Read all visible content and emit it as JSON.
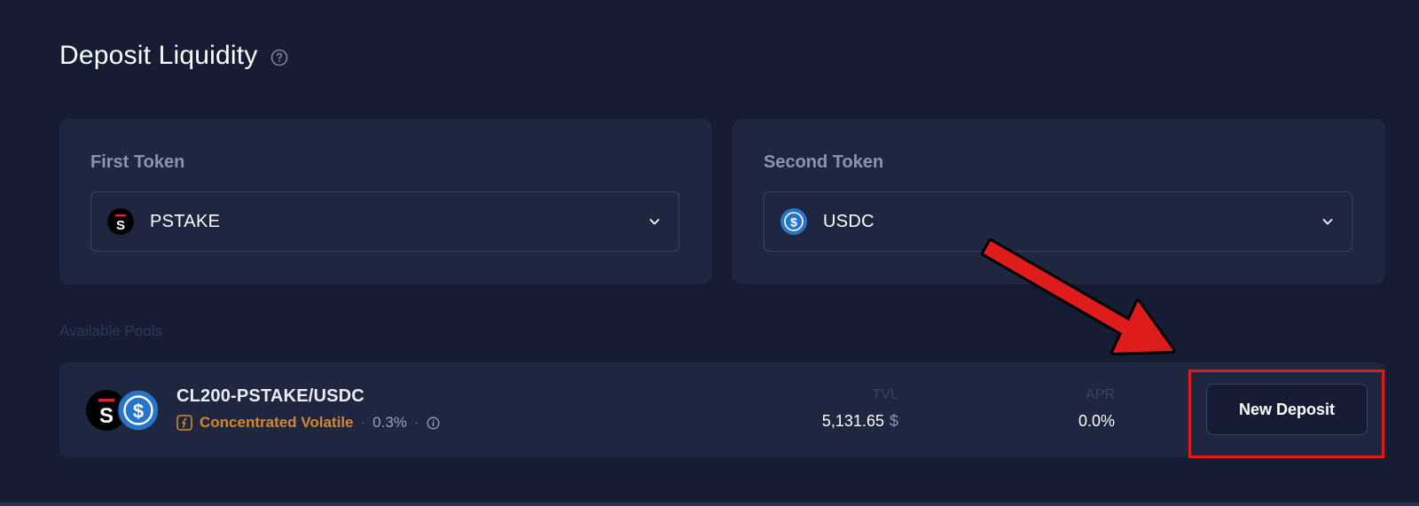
{
  "header": {
    "title": "Deposit Liquidity",
    "help_icon": "question-circle-icon"
  },
  "first_token": {
    "label": "First Token",
    "value": "PSTAKE",
    "icon": "pstake-logo"
  },
  "second_token": {
    "label": "Second Token",
    "value": "USDC",
    "icon": "usdc-logo"
  },
  "pools": {
    "section_label": "Available Pools",
    "items": [
      {
        "name": "CL200-PSTAKE/USDC",
        "type": "Concentrated Volatile",
        "fee": "0.3%",
        "tvl_label": "TVL",
        "tvl_value": "5,131.65",
        "tvl_currency": "$",
        "apr_label": "APR",
        "apr_value": "0.0%",
        "action_label": "New Deposit"
      }
    ]
  },
  "colors": {
    "background": "#151c33",
    "card": "#1f2640",
    "accent_orange": "#d4872a",
    "annotation_red": "#e01b1b",
    "usdc_blue": "#2775ca"
  }
}
